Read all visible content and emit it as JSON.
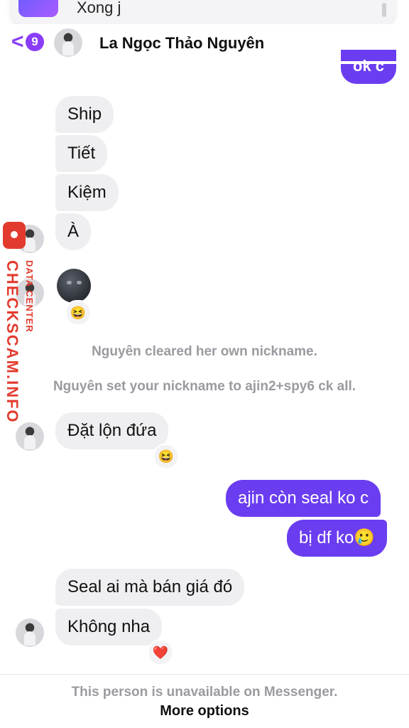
{
  "notification": {
    "text": "Xong j"
  },
  "header": {
    "unread_count": "9",
    "contact_name": "La Ngọc Thảo Nguyên",
    "back_glyph": "<"
  },
  "messages": {
    "top_out": "ok c",
    "m1": "Ship",
    "m2": "Tiết",
    "m3": "Kiệm",
    "m4": "À",
    "moon_emoji_icon": "new-moon-face-icon",
    "react1": "😆",
    "sys1": "Nguyên cleared her own nickname.",
    "sys2": "Nguyên set your nickname to ajin2+spy6 ck all.",
    "m5": "Đặt lộn đứa",
    "react2": "😆",
    "o1": "ajin còn seal ko c",
    "o2": "bị df ko🥲",
    "m6": "Seal ai mà bán giá đó",
    "m7": "Không nha",
    "react3": "❤️"
  },
  "footer": {
    "note": "This person is unavailable on Messenger.",
    "link": "More options"
  },
  "watermark": {
    "main": "CHECKSCAM.INFO",
    "sub": "DATA CENTER"
  },
  "colors": {
    "accent": "#8a3cf6",
    "outgoing": "#6a3df0",
    "incoming": "#efeff1",
    "watermark": "#e23b2e"
  }
}
